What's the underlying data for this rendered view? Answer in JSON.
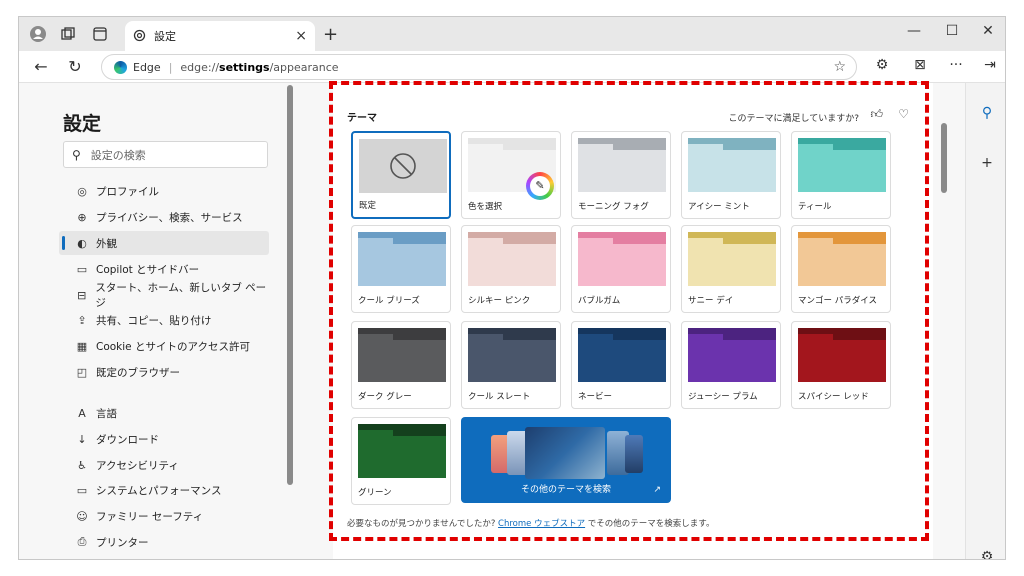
{
  "tab": {
    "title": "設定",
    "close": "×"
  },
  "new_tab": "+",
  "window_controls": {
    "minimize": "—",
    "maximize": "☐",
    "close": "✕"
  },
  "addressbar": {
    "site": "Edge",
    "url_scheme": "edge://",
    "url_strong": "settings",
    "url_rest": "/appearance"
  },
  "sidebar": {
    "title": "設定",
    "search_placeholder": "設定の検索",
    "items": [
      {
        "label": "プロファイル",
        "icon": "profile-icon",
        "glyph": "◎"
      },
      {
        "label": "プライバシー、検索、サービス",
        "icon": "lock-icon",
        "glyph": "⊕"
      },
      {
        "label": "外観",
        "icon": "appearance-icon",
        "glyph": "◐",
        "active": true
      },
      {
        "label": "Copilot とサイドバー",
        "icon": "sidebar-icon",
        "glyph": "▭"
      },
      {
        "label": "スタート、ホーム、新しいタブ ページ",
        "icon": "home-icon",
        "glyph": "⊟"
      },
      {
        "label": "共有、コピー、貼り付け",
        "icon": "share-icon",
        "glyph": "⇪"
      },
      {
        "label": "Cookie とサイトのアクセス許可",
        "icon": "cookie-icon",
        "glyph": "▦"
      },
      {
        "label": "既定のブラウザー",
        "icon": "browser-icon",
        "glyph": "◰"
      },
      {
        "label": "言語",
        "icon": "language-icon",
        "glyph": "A"
      },
      {
        "label": "ダウンロード",
        "icon": "download-icon",
        "glyph": "↓"
      },
      {
        "label": "アクセシビリティ",
        "icon": "accessibility-icon",
        "glyph": "♿"
      },
      {
        "label": "システムとパフォーマンス",
        "icon": "system-icon",
        "glyph": "▭"
      },
      {
        "label": "ファミリー セーフティ",
        "icon": "family-icon",
        "glyph": "☺"
      },
      {
        "label": "プリンター",
        "icon": "printer-icon",
        "glyph": "⎙"
      }
    ]
  },
  "theme": {
    "title": "テーマ",
    "feedback": "このテーマに満足していますか?",
    "cards": [
      {
        "label": "既定",
        "tab": "#c9c9c9",
        "body": "#d4d4d4"
      },
      {
        "label": "色を選択",
        "tab": "#e4e4e4",
        "body": "#f2f2f2"
      },
      {
        "label": "モーニング フォグ",
        "tab": "#a8adb3",
        "body": "#dfe1e4"
      },
      {
        "label": "アイシー ミント",
        "tab": "#7fb2c0",
        "body": "#c7e2e8"
      },
      {
        "label": "ティール",
        "tab": "#3aa9a0",
        "body": "#70d3c9"
      },
      {
        "label": "クール ブリーズ",
        "tab": "#6a9dc5",
        "body": "#a6c7e0"
      },
      {
        "label": "シルキー ピンク",
        "tab": "#d3aba5",
        "body": "#f2dcd9"
      },
      {
        "label": "バブルガム",
        "tab": "#e47ea1",
        "body": "#f6b8cc"
      },
      {
        "label": "サニー デイ",
        "tab": "#d0b756",
        "body": "#f0e3b0"
      },
      {
        "label": "マンゴー パラダイス",
        "tab": "#e3963b",
        "body": "#f2c896"
      },
      {
        "label": "ダーク グレー",
        "tab": "#3d3d3f",
        "body": "#5a5b5d"
      },
      {
        "label": "クール スレート",
        "tab": "#2f3a4c",
        "body": "#4a566b"
      },
      {
        "label": "ネービー",
        "tab": "#15365e",
        "body": "#1e4a7d"
      },
      {
        "label": "ジューシー プラム",
        "tab": "#4c2380",
        "body": "#6b33ad"
      },
      {
        "label": "スパイシー レッド",
        "tab": "#6e0f14",
        "body": "#a3161d"
      },
      {
        "label": "グリーン",
        "tab": "#14401d",
        "body": "#1f6b2e"
      }
    ],
    "more_themes": "その他のテーマを検索",
    "footer_prefix": "必要なものが見つかりませんでしたか?",
    "footer_link": "Chrome ウェブストア",
    "footer_suffix": "でその他のテーマを検索します。"
  }
}
